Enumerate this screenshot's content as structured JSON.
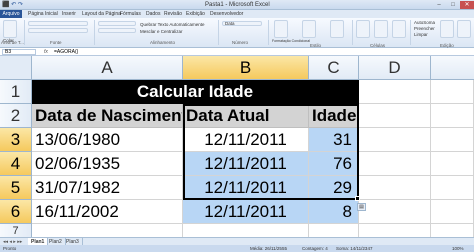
{
  "window": {
    "title": "Pasta1 - Microsoft Excel",
    "quick_access": "⬛ ↶ ↷",
    "controls": {
      "minimize": "–",
      "maximize": "□",
      "close": "✕"
    }
  },
  "ribbon": {
    "tabs": [
      "Arquivo",
      "Página Inicial",
      "Inserir",
      "Layout da Página",
      "Fórmulas",
      "Dados",
      "Revisão",
      "Exibição",
      "Desenvolvedor"
    ],
    "groups": [
      "Área de T...",
      "Fonte",
      "Alinhamento",
      "Número",
      "Estilo",
      "Células",
      "Edição"
    ],
    "controls": {
      "paste": "Colar",
      "wrap_text": "Quebrar Texto Automaticamente",
      "merge_center": "Mesclar e Centralizar",
      "number_format": "Data",
      "conditional_format": "Formatação Condicional",
      "format_table": "Formatar como Tabela",
      "cell_styles": "Estilos de Célula",
      "insert": "Inserir",
      "delete": "Excluir",
      "format": "Formatar",
      "autosum": "AutoSoma",
      "fill": "Preencher",
      "clear": "Limpar",
      "sort_filter": "Classificar e Filtrar",
      "find_select": "Localizar e Selecionar"
    }
  },
  "formula_bar": {
    "name_box": "B3",
    "fx": "fx",
    "formula": "=AGORA()"
  },
  "columns": [
    "A",
    "B",
    "C",
    "D"
  ],
  "rows": [
    "1",
    "2",
    "3",
    "4",
    "5",
    "6",
    "7"
  ],
  "sheet": {
    "title": "Calcular Idade",
    "headers": {
      "a": "Data de Nascimento",
      "b": "Data Atual",
      "c": "Idade"
    },
    "data": [
      {
        "birth": "13/06/1980",
        "current": "12/11/2011",
        "age": "31"
      },
      {
        "birth": "02/06/1935",
        "current": "12/11/2011",
        "age": "76"
      },
      {
        "birth": "31/07/1982",
        "current": "12/11/2011",
        "age": "29"
      },
      {
        "birth": "16/11/2002",
        "current": "12/11/2011",
        "age": "8"
      }
    ]
  },
  "sheet_tabs": [
    "Plan1",
    "Plan2",
    "Plan3"
  ],
  "status": {
    "mode": "Pronto",
    "average": "Média: 26/11/2555",
    "count": "Contagem: 4",
    "sum": "Soma: 14/11/2347",
    "zoom": "100%"
  },
  "colors": {
    "selected_range": "#b8d6f5",
    "header_fill": "#d3d3d3",
    "title_fill": "#000000",
    "ribbon_accent": "#2a5699"
  }
}
